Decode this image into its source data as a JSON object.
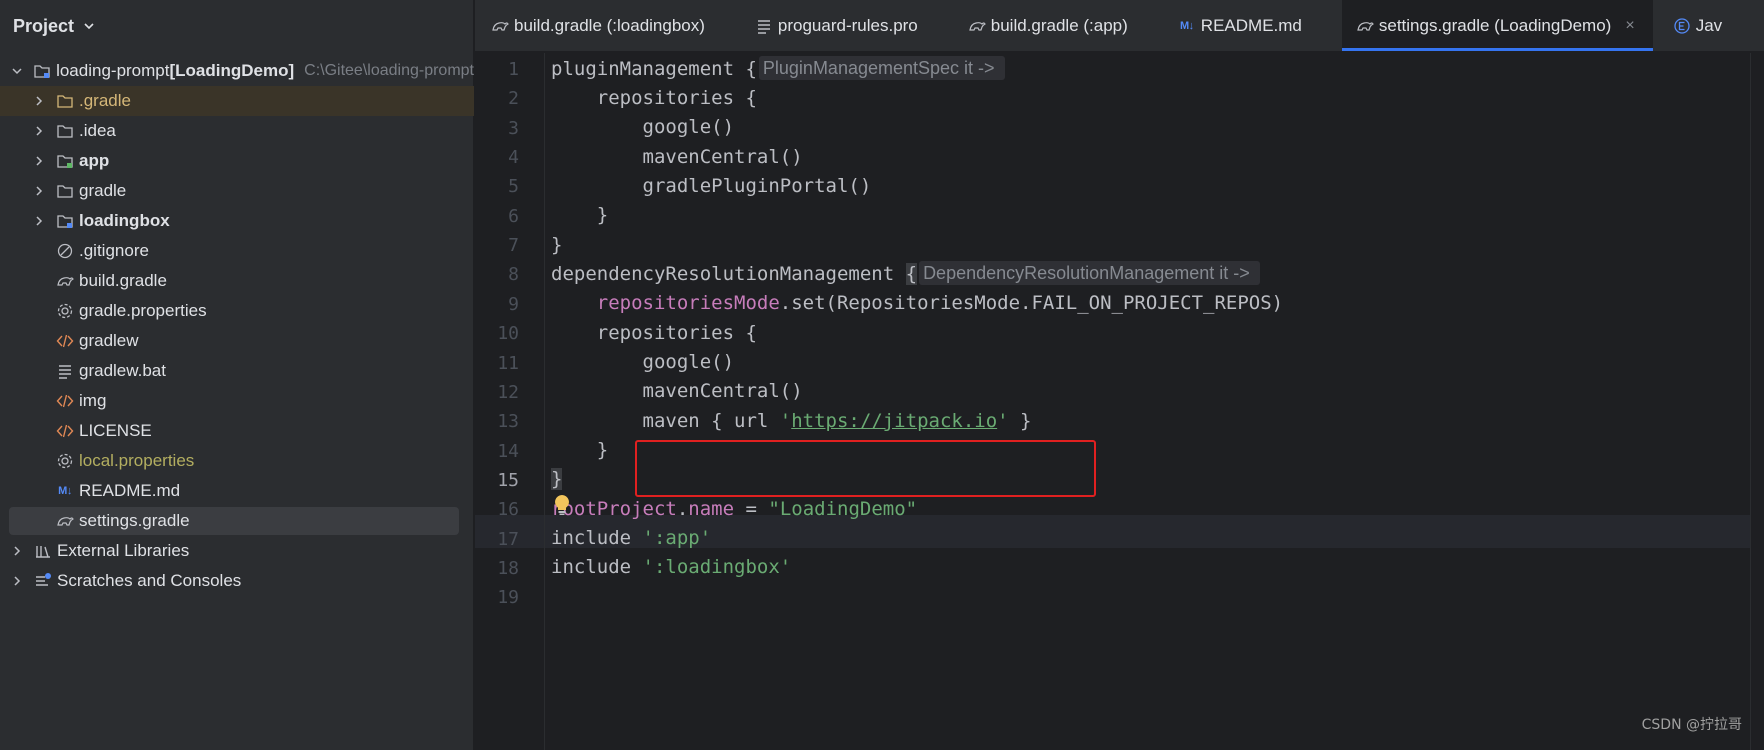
{
  "project_panel": {
    "title": "Project",
    "tree": [
      {
        "label": "loading-prompt ",
        "label_bold": "[LoadingDemo]",
        "path": "C:\\Gitee\\loading-prompt",
        "icon": "module-folder-icon",
        "expanded": true
      },
      {
        "label": ".gradle",
        "icon": "folder-icon",
        "style": "orange"
      },
      {
        "label": ".idea",
        "icon": "folder-icon"
      },
      {
        "label": "app",
        "icon": "module-folder-icon",
        "style": "bold"
      },
      {
        "label": "gradle",
        "icon": "folder-icon"
      },
      {
        "label": "loadingbox",
        "icon": "module-folder-icon",
        "style": "bold"
      },
      {
        "label": ".gitignore",
        "icon": "ignore-icon"
      },
      {
        "label": "build.gradle",
        "icon": "gradle-icon"
      },
      {
        "label": "gradle.properties",
        "icon": "gear-icon"
      },
      {
        "label": "gradlew",
        "icon": "code-icon"
      },
      {
        "label": "gradlew.bat",
        "icon": "text-lines-icon"
      },
      {
        "label": "img",
        "icon": "code-icon"
      },
      {
        "label": "LICENSE",
        "icon": "code-icon"
      },
      {
        "label": "local.properties",
        "icon": "gear-icon",
        "style": "yellow"
      },
      {
        "label": "README.md",
        "icon": "markdown-icon"
      },
      {
        "label": "settings.gradle",
        "icon": "gradle-icon"
      },
      {
        "label": "External Libraries",
        "icon": "library-icon"
      },
      {
        "label": "Scratches and Consoles",
        "icon": "scratches-icon"
      }
    ]
  },
  "tabs": [
    {
      "label": "build.gradle (:loadingbox)",
      "icon": "gradle-icon"
    },
    {
      "label": "proguard-rules.pro",
      "icon": "text-lines-icon"
    },
    {
      "label": "build.gradle (:app)",
      "icon": "gradle-icon"
    },
    {
      "label": "README.md",
      "icon": "markdown-icon",
      "mark": "M↓"
    },
    {
      "label": "settings.gradle (LoadingDemo)",
      "icon": "gradle-icon",
      "active": true,
      "close": "×"
    },
    {
      "label": "Jav",
      "icon": "enum-icon"
    }
  ],
  "editor": {
    "line_numbers": [
      "1",
      "2",
      "3",
      "4",
      "5",
      "6",
      "7",
      "8",
      "9",
      "10",
      "11",
      "12",
      "13",
      "14",
      "15",
      "16",
      "17",
      "18",
      "19"
    ],
    "current_line": "15",
    "lines": {
      "l1_code": "pluginManagement {",
      "l1_hint": "PluginManagementSpec it ->",
      "l2": "    repositories {",
      "l3": "        google()",
      "l4": "        mavenCentral()",
      "l5": "        gradlePluginPortal()",
      "l6": "    }",
      "l7": "}",
      "l8_code": "dependencyResolutionManagement ",
      "l8_brace": "{",
      "l8_hint": "DependencyResolutionManagement it ->",
      "l9_indent": "    ",
      "l9_prop": "repositoriesMode",
      "l9_rest": ".set(RepositoriesMode.FAIL_ON_PROJECT_REPOS)",
      "l10": "    repositories {",
      "l11": "        google()",
      "l12": "        mavenCentral()",
      "l13_pre": "        maven { url ",
      "l13_q1": "'",
      "l13_url": "https://jitpack.io",
      "l13_q2": "'",
      "l13_post": " }",
      "l14": "    }",
      "l15": "}",
      "l16_prop": "rootProject",
      "l16_dot": ".",
      "l16_prop2": "name",
      "l16_eq": " = ",
      "l16_str": "\"LoadingDemo\"",
      "l17_kw": "include ",
      "l17_str": "':app'",
      "l18_kw": "include ",
      "l18_str": "':loadingbox'"
    }
  },
  "watermark": "CSDN @拧拉哥",
  "colors": {
    "accent": "#3574f0",
    "highlight_box": "#e02020",
    "string": "#6aab73",
    "property": "#c77dbb"
  }
}
